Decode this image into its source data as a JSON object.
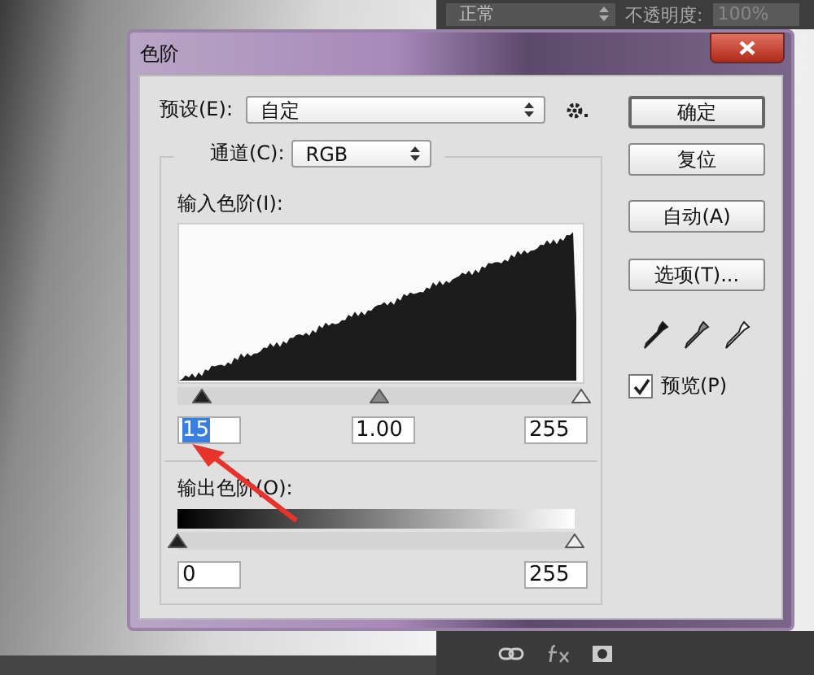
{
  "top_panel": {
    "blend_mode": "正常",
    "opacity_label": "不透明度:",
    "opacity": "100%"
  },
  "dialog": {
    "title": "色阶",
    "preset": {
      "label": "预设(E):",
      "value": "自定"
    },
    "channel": {
      "label": "通道(C):",
      "value": "RGB"
    },
    "input_levels": {
      "label": "输入色阶(I):",
      "thumbs": [
        {
          "kind": "black",
          "level": 0.06
        },
        {
          "kind": "gray",
          "level": 0.5
        },
        {
          "kind": "white",
          "level": 1
        }
      ],
      "fields": [
        {
          "value": "15",
          "selected": true
        },
        {
          "value": "1.00",
          "selected": false
        },
        {
          "value": "255",
          "selected": false
        }
      ]
    },
    "output_levels": {
      "label": "输出色阶(O):",
      "thumbs": [
        {
          "kind": "black",
          "level": 0
        },
        {
          "kind": "white",
          "level": 1
        }
      ],
      "fields": [
        {
          "value": "0",
          "selected": false
        },
        {
          "value": "255",
          "selected": false
        }
      ]
    },
    "buttons": [
      {
        "label": "确定",
        "default": true
      },
      {
        "label": "复位",
        "default": false
      },
      {
        "label": "自动(A)",
        "default": false
      },
      {
        "label": "选项(T)...",
        "default": false
      }
    ],
    "preview": {
      "label": "预览(P)",
      "checked": true
    }
  }
}
